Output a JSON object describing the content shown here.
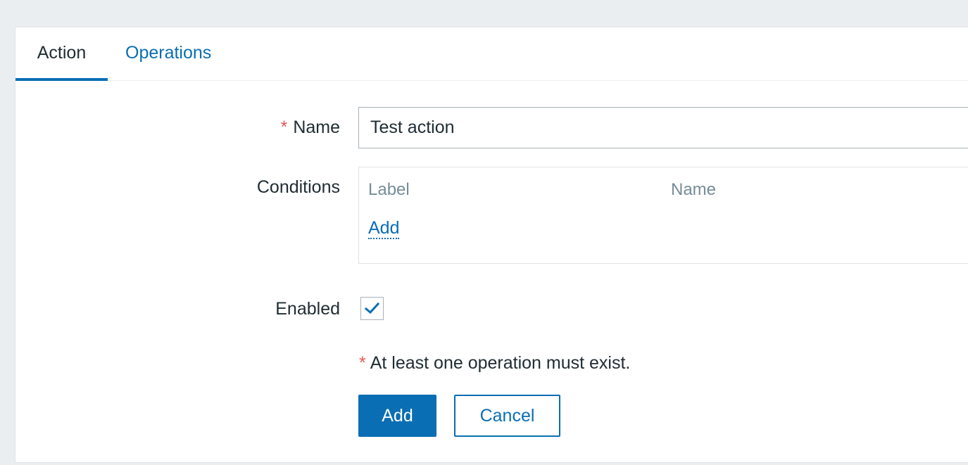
{
  "tabs": [
    {
      "label": "Action",
      "active": true
    },
    {
      "label": "Operations",
      "active": false
    }
  ],
  "form": {
    "name": {
      "required_mark": "*",
      "label": "Name",
      "value": "Test action"
    },
    "conditions": {
      "label": "Conditions",
      "columns": [
        "Label",
        "Name"
      ],
      "add_link": "Add"
    },
    "enabled": {
      "label": "Enabled",
      "checked": true
    },
    "note": {
      "required_mark": "*",
      "text": "At least one operation must exist."
    }
  },
  "buttons": {
    "add": "Add",
    "cancel": "Cancel"
  },
  "colors": {
    "accent": "#0a6eb4",
    "required": "#e45959",
    "background": "#ebeef0"
  },
  "icons": {
    "enabled_checkbox": "checkmark-icon"
  }
}
